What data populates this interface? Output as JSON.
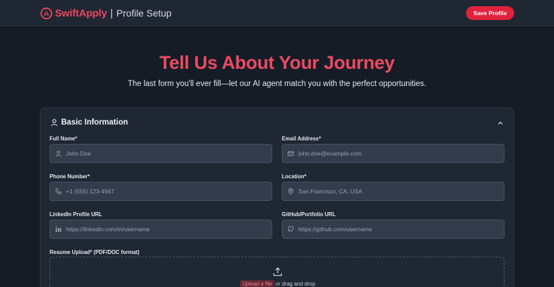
{
  "header": {
    "brand": "SwiftApply",
    "separator": "|",
    "page_title": "Profile Setup",
    "save_label": "Save Profile"
  },
  "hero": {
    "title": "Tell Us About Your Journey",
    "subtitle": "The last form you'll ever fill—let our AI agent match you with the perfect opportunities."
  },
  "section": {
    "title": "Basic Information",
    "fields": {
      "full_name": {
        "label": "Full Name*",
        "placeholder": "John Doe",
        "icon": "user-icon"
      },
      "email": {
        "label": "Email Address*",
        "placeholder": "john.doe@example.com",
        "icon": "mail-icon"
      },
      "phone": {
        "label": "Phone Number*",
        "placeholder": "+1 (555) 123-4567",
        "icon": "phone-icon"
      },
      "location": {
        "label": "Location*",
        "placeholder": "San Francisco, CA, USA",
        "icon": "map-pin-icon"
      },
      "linkedin": {
        "label": "LinkedIn Profile URL",
        "placeholder": "https://linkedin.com/in/username",
        "icon": "linkedin-icon"
      },
      "github": {
        "label": "GitHub/Portfolio URL",
        "placeholder": "https://github.com/username",
        "icon": "github-icon"
      }
    },
    "resume": {
      "label": "Resume Upload* (PDF/DOC format)",
      "upload_link": "Upload a file",
      "upload_text": "or drag and drop"
    }
  },
  "colors": {
    "accent": "#e0223d",
    "title": "#ea4b63",
    "background": "#161c26",
    "card": "#1f2733",
    "input": "#323c4a"
  }
}
